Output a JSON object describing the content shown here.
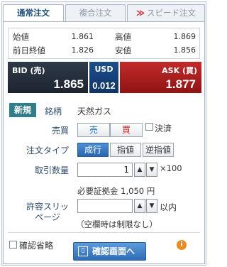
{
  "tabs": [
    {
      "label": "通常注文",
      "active": true
    },
    {
      "label": "複合注文",
      "active": false
    },
    {
      "label": "スピード注文",
      "active": false
    }
  ],
  "summary": {
    "open_label": "始値",
    "open_value": "1.861",
    "high_label": "高値",
    "high_value": "1.869",
    "prev_close_label": "前日終値",
    "prev_close_value": "1.826",
    "low_label": "安値",
    "low_value": "1.856"
  },
  "quote": {
    "bid_label": "BID (売)",
    "bid_price": "1.865",
    "currency": "USD",
    "spread": "0.012",
    "ask_label": "ASK (買)",
    "ask_price": "1.877"
  },
  "form": {
    "new_badge": "新規",
    "symbol_label": "銘柄",
    "symbol_value": "天然ガス",
    "side_label": "売買",
    "sell_label": "売",
    "buy_label": "買",
    "settle_label": "決済",
    "order_type_label": "注文タイプ",
    "order_types": [
      "成行",
      "指値",
      "逆指値"
    ],
    "quantity_label": "取引数量",
    "quantity_value": "1",
    "quantity_unit": "×100",
    "margin_text": "必要証拠金 1,050 円",
    "slippage_label": "許容スリッページ",
    "slippage_value": "",
    "slippage_unit": "以内",
    "slippage_note": "（空欄時は制限なし）",
    "skip_confirm_label": "確認省略",
    "confirm_button": "確認画面へ"
  },
  "colors": {
    "bid_bg": "#1c2430",
    "usd_bg": "#0f3467",
    "ask_bg": "#8f1414",
    "accent": "#2a67b0",
    "new_badge_bg": "#2f7f8a"
  }
}
